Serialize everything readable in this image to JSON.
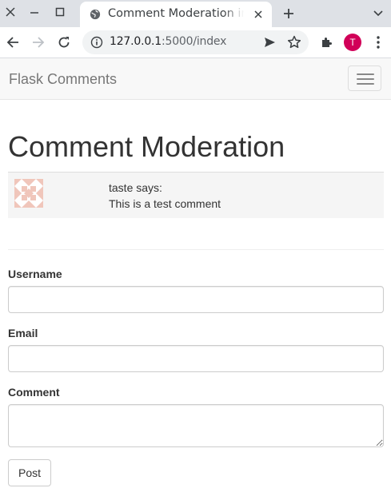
{
  "browser": {
    "tab": {
      "title": "Comment Moderation in Flask",
      "favicon": "globe-icon"
    },
    "url": {
      "host": "127.0.0.1",
      "rest": ":5000/index"
    },
    "profile_initial": "T",
    "profile_color": "#d10058"
  },
  "navbar": {
    "brand": "Flask Comments"
  },
  "page": {
    "title": "Comment Moderation"
  },
  "comments": [
    {
      "author_line": "taste says:",
      "body": "This is a test comment",
      "avatar": "identicon-avatar"
    }
  ],
  "form": {
    "username_label": "Username",
    "email_label": "Email",
    "comment_label": "Comment",
    "username_value": "",
    "email_value": "",
    "comment_value": "",
    "submit_label": "Post"
  }
}
